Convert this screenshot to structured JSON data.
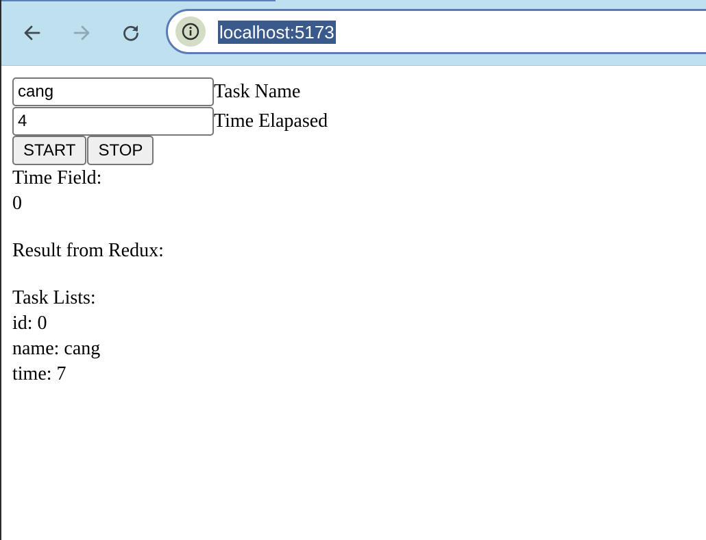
{
  "browser": {
    "url": "localhost:5173",
    "icons": {
      "back": "arrow-left-icon",
      "forward": "arrow-right-icon",
      "reload": "reload-icon",
      "site_info": "info-icon"
    },
    "colors": {
      "toolbar_bg": "#bfe0ee",
      "omnibox_border": "#5c7bb5",
      "url_selection": "#3b5a8c"
    }
  },
  "form": {
    "task_name_value": "cang",
    "task_name_label": "Task Name",
    "time_elapsed_value": "4",
    "time_elapsed_label": "Time Elapased",
    "start_label": "START",
    "stop_label": "STOP"
  },
  "time_field": {
    "label": "Time Field:",
    "value": "0"
  },
  "redux": {
    "label": "Result from Redux:"
  },
  "task_lists": {
    "label": "Task Lists:",
    "items": [
      {
        "id": "id: 0",
        "name": "name: cang",
        "time": "time: 7"
      }
    ]
  }
}
